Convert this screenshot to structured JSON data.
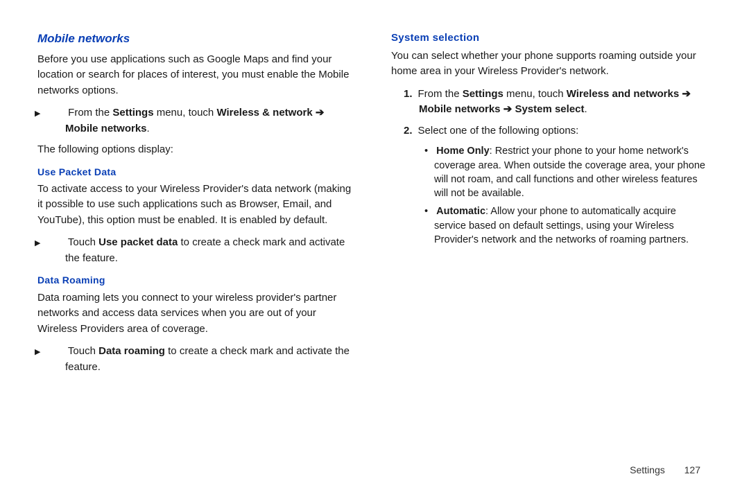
{
  "left": {
    "heading": "Mobile networks",
    "intro": "Before you use applications such as Google Maps and find your location or search for places of interest, you must enable the Mobile networks options.",
    "step_prefix": "From the ",
    "step_b1": "Settings",
    "step_mid": " menu, touch ",
    "step_b2": "Wireless & network",
    "step_arrow": " ➔ ",
    "step_b3": "Mobile networks",
    "step_end": ".",
    "after": "The following options display:",
    "h_upd": "Use Packet Data",
    "upd_body": "To activate access to your Wireless Provider's data network (making it possible to use such applications such as Browser, Email, and YouTube), this option must be enabled. It is enabled by default.",
    "upd_step_a": "Touch ",
    "upd_step_b": "Use packet data",
    "upd_step_c": " to create a check mark and activate the feature.",
    "h_dr": "Data Roaming",
    "dr_body": "Data roaming lets you connect to your wireless provider's partner networks and access data services when you are out of your Wireless Providers area of coverage.",
    "dr_step_a": "Touch ",
    "dr_step_b": "Data roaming",
    "dr_step_c": " to create a check mark and activate the feature."
  },
  "right": {
    "heading": "System selection",
    "intro": "You can select whether your phone supports roaming outside your home area in your Wireless Provider's network.",
    "s1_num": "1.",
    "s1_a": "From the ",
    "s1_b1": "Settings",
    "s1_b": " menu, touch ",
    "s1_b2": "Wireless and networks",
    "s1_arrow": " ➔ ",
    "s1_b3": "Mobile networks",
    "s1_b4": "System select",
    "s1_end": ".",
    "s2_num": "2.",
    "s2_text": "Select one of the following options:",
    "opt1_b": "Home Only",
    "opt1_t": ": Restrict your phone to your home network's coverage area. When outside the coverage area, your phone will not roam, and call functions and other wireless features will not be available.",
    "opt2_b": "Automatic",
    "opt2_t": ": Allow your phone to automatically acquire service based on default settings, using your Wireless Provider's network and the networks of roaming partners."
  },
  "footer": {
    "section": "Settings",
    "page": "127"
  }
}
